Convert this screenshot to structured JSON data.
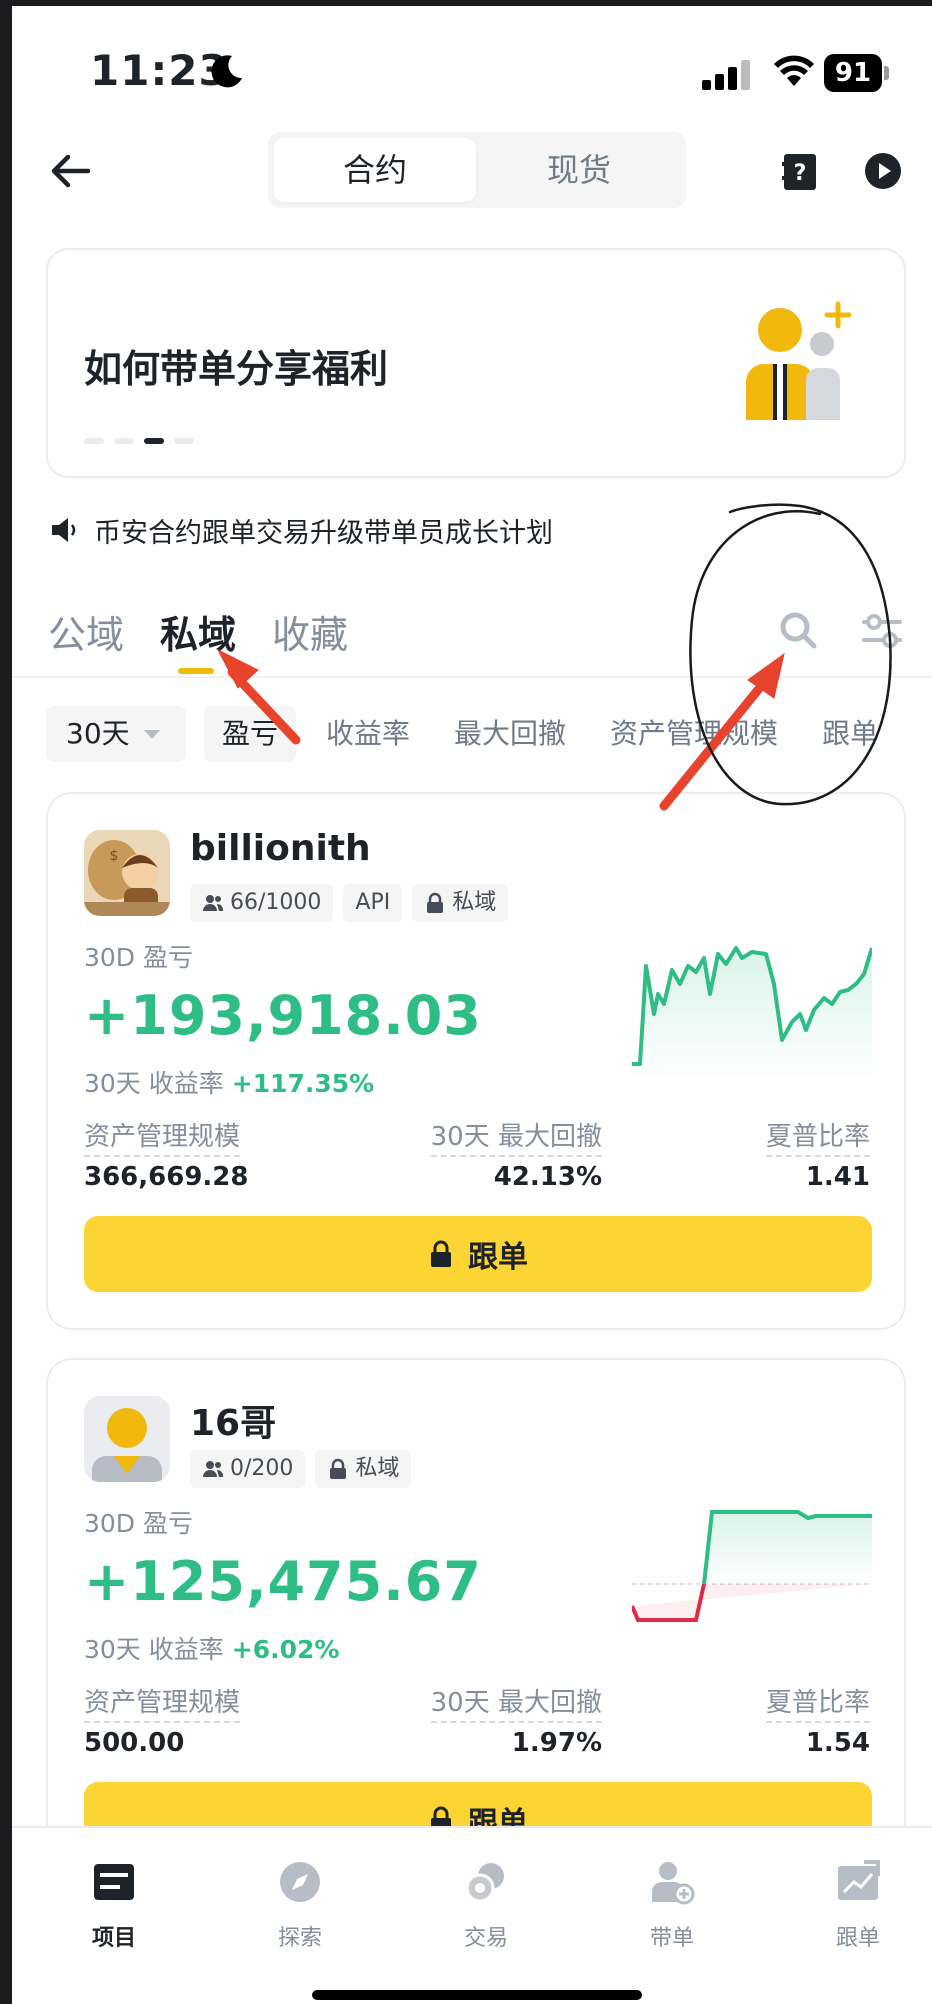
{
  "status_bar": {
    "time": "11:23",
    "battery": "91"
  },
  "header": {
    "segments": [
      "合约",
      "现货"
    ],
    "active_segment": 0
  },
  "banner": {
    "title": "如何带单分享福利"
  },
  "announcement": {
    "text": "币安合约跟单交易升级带单员成长计划"
  },
  "tabs": {
    "items": [
      "公域",
      "私域",
      "收藏"
    ],
    "active": 1
  },
  "filters": {
    "period": "30天",
    "chips": [
      "盈亏",
      "收益率",
      "最大回撤",
      "资产管理规模",
      "跟单"
    ]
  },
  "labels": {
    "pnl": "30D 盈亏",
    "roi": "30天 收益率",
    "aum": "资产管理规模",
    "mdd": "30天 最大回撤",
    "sharpe": "夏普比率",
    "follow": "跟单"
  },
  "traders": [
    {
      "name": "billionith",
      "badges": [
        "66/1000",
        "API",
        "私域"
      ],
      "pnl": "+193,918.03",
      "roi": "+117.35%",
      "aum": "366,669.28",
      "mdd": "42.13%",
      "sharpe": "1.41"
    },
    {
      "name": "16哥",
      "badges": [
        "0/200",
        "私域"
      ],
      "pnl": "+125,475.67",
      "roi": "+6.02%",
      "aum": "500.00",
      "mdd": "1.97%",
      "sharpe": "1.54"
    }
  ],
  "bottom_nav": {
    "items": [
      "项目",
      "探索",
      "交易",
      "带单",
      "跟单"
    ],
    "active": 0
  },
  "colors": {
    "accent": "#fcd535",
    "positive": "#2ebd85",
    "negative": "#e0294a",
    "annotation": "#e8432d"
  }
}
